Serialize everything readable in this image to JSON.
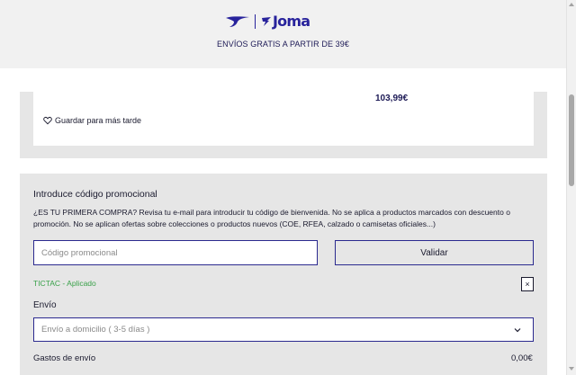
{
  "brand": {
    "name": "Joma",
    "color": "#28239c"
  },
  "banner": {
    "text": "ENVÍOS GRATIS A PARTIR DE 39€"
  },
  "cart_item": {
    "price": "103,99€",
    "save_later_label": "Guardar para más tarde",
    "icon": "heart-icon"
  },
  "promo": {
    "title": "Introduce código promocional",
    "description": "¿ES TU PRIMERA COMPRA? Revisa tu e-mail para introducir tu código de bienvenida. No se aplica a productos marcados con descuento o promoción. No se aplican ofertas sobre colecciones o productos nuevos (COE, RFEA, calzado o camisetas oficiales...)",
    "input_placeholder": "Código promocional",
    "input_value": "",
    "validate_label": "Validar",
    "applied_text": "TICTAC - Aplicado",
    "remove_label": "×",
    "applied_color": "#3aa14a"
  },
  "shipping": {
    "label": "Envío",
    "selected_option": "Envío a domicilio ( 3-5 días )",
    "cost_label": "Gastos de envío",
    "cost_value": "0,00€"
  },
  "colors": {
    "accent": "#2b2a8f",
    "panel_bg": "#e6e6e6",
    "header_bg": "#f1f1f1"
  }
}
